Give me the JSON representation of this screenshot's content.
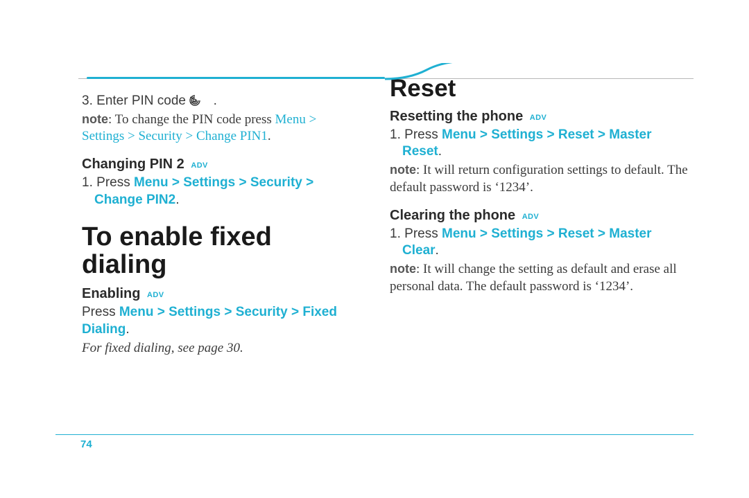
{
  "pageNumber": "74",
  "left": {
    "step3": {
      "num": "3.",
      "text": "Enter PIN code > ",
      "iconName": "swirl-icon"
    },
    "noteLabel": "note",
    "note1": ": To change the PIN code press ",
    "note2_blue": "Menu > Settings > Security > Change PIN1",
    "note3": ".",
    "changePin2": {
      "heading": "Changing PIN 2",
      "stepNum": "1.",
      "pre": "Press ",
      "blue": "Menu > Settings > Security > Change PIN2",
      "post": "."
    },
    "fixedDialing": {
      "h1": "To enable fixed dialing",
      "enabling": "Enabling",
      "pre": "Press ",
      "blue": "Menu > Settings > Security > Fixed Dialing",
      "post": ".",
      "seePage": "For fixed dialing, see page 30."
    }
  },
  "right": {
    "resetH1": "Reset",
    "resetting": {
      "heading": "Resetting the phone",
      "stepNum": "1.",
      "pre": "Press ",
      "blue": "Menu > Settings > Reset > Master Reset",
      "post": ".",
      "noteLabel": "note",
      "noteText": ": It will return configuration settings to default. The default password is ‘1234’."
    },
    "clearing": {
      "heading": "Clearing the phone",
      "stepNum": "1.",
      "pre": "Press ",
      "blue": "Menu > Settings > Reset > Master Clear",
      "post": ".",
      "noteLabel": "note",
      "noteText": ": It will change the setting as default and erase all personal data. The default password is ‘1234’."
    }
  },
  "advBadge": "ADV"
}
